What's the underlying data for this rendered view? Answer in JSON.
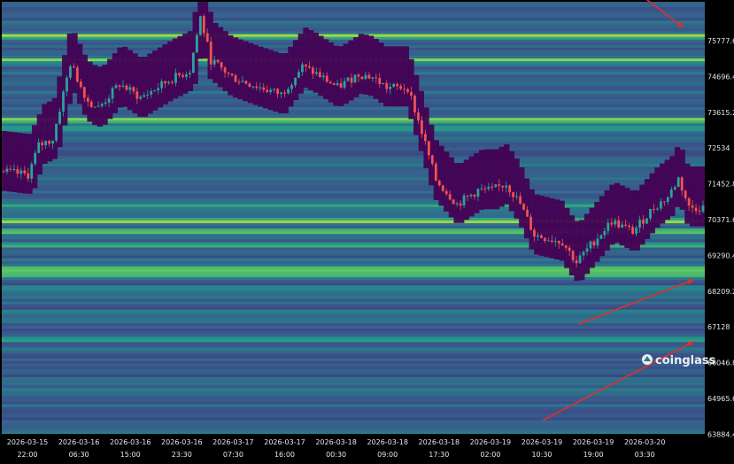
{
  "chart_data": {
    "type": "heatmap",
    "subtype": "liquidation-heatmap-with-candles",
    "title": "",
    "xlabel": "",
    "ylabel": "",
    "y_ticks": [
      "75777.6",
      "74696.4",
      "73615.2",
      "72534",
      "71452.8",
      "70371.6",
      "69290.4",
      "68209.2",
      "67128",
      "66046.8",
      "64965.6",
      "63884.4"
    ],
    "x_ticks": [
      {
        "date": "2026-03-15",
        "time": "22:00"
      },
      {
        "date": "2026-03-16",
        "time": "06:30"
      },
      {
        "date": "2026-03-16",
        "time": "15:00"
      },
      {
        "date": "2026-03-16",
        "time": "23:30"
      },
      {
        "date": "2026-03-17",
        "time": "07:30"
      },
      {
        "date": "2026-03-17",
        "time": "16:00"
      },
      {
        "date": "2026-03-18",
        "time": "00:30"
      },
      {
        "date": "2026-03-18",
        "time": "09:00"
      },
      {
        "date": "2026-03-18",
        "time": "17:30"
      },
      {
        "date": "2026-03-19",
        "time": "02:00"
      },
      {
        "date": "2026-03-19",
        "time": "10:30"
      },
      {
        "date": "2026-03-19",
        "time": "19:00"
      },
      {
        "date": "2026-03-20",
        "time": "03:30"
      }
    ],
    "ylim": [
      63800,
      76400
    ],
    "price_path": [
      {
        "t": 0,
        "p": 71450
      },
      {
        "t": 0.04,
        "p": 71350
      },
      {
        "t": 0.055,
        "p": 72200
      },
      {
        "t": 0.075,
        "p": 72400
      },
      {
        "t": 0.1,
        "p": 74600
      },
      {
        "t": 0.125,
        "p": 73500
      },
      {
        "t": 0.14,
        "p": 73300
      },
      {
        "t": 0.17,
        "p": 74000
      },
      {
        "t": 0.2,
        "p": 73600
      },
      {
        "t": 0.24,
        "p": 74100
      },
      {
        "t": 0.27,
        "p": 74400
      },
      {
        "t": 0.285,
        "p": 75950
      },
      {
        "t": 0.3,
        "p": 74700
      },
      {
        "t": 0.33,
        "p": 74200
      },
      {
        "t": 0.37,
        "p": 73900
      },
      {
        "t": 0.4,
        "p": 73700
      },
      {
        "t": 0.43,
        "p": 74500
      },
      {
        "t": 0.45,
        "p": 74300
      },
      {
        "t": 0.48,
        "p": 73900
      },
      {
        "t": 0.51,
        "p": 74300
      },
      {
        "t": 0.53,
        "p": 74200
      },
      {
        "t": 0.55,
        "p": 73900
      },
      {
        "t": 0.58,
        "p": 73900
      },
      {
        "t": 0.6,
        "p": 72600
      },
      {
        "t": 0.62,
        "p": 71200
      },
      {
        "t": 0.65,
        "p": 70500
      },
      {
        "t": 0.68,
        "p": 70900
      },
      {
        "t": 0.7,
        "p": 70900
      },
      {
        "t": 0.72,
        "p": 71100
      },
      {
        "t": 0.74,
        "p": 70500
      },
      {
        "t": 0.76,
        "p": 69600
      },
      {
        "t": 0.8,
        "p": 69400
      },
      {
        "t": 0.82,
        "p": 68800
      },
      {
        "t": 0.84,
        "p": 69300
      },
      {
        "t": 0.87,
        "p": 70000
      },
      {
        "t": 0.9,
        "p": 69700
      },
      {
        "t": 0.93,
        "p": 70400
      },
      {
        "t": 0.95,
        "p": 70700
      },
      {
        "t": 0.965,
        "p": 71250
      },
      {
        "t": 0.98,
        "p": 70400
      },
      {
        "t": 1,
        "p": 70400
      }
    ],
    "liquidity_bands": [
      {
        "price": 75400,
        "intensity": 0.95
      },
      {
        "price": 74700,
        "intensity": 0.85
      },
      {
        "price": 72950,
        "intensity": 0.95
      },
      {
        "price": 72700,
        "intensity": 0.7
      },
      {
        "price": 70450,
        "intensity": 0.6
      },
      {
        "price": 70000,
        "intensity": 0.95
      },
      {
        "price": 69700,
        "intensity": 0.9
      },
      {
        "price": 69300,
        "intensity": 0.75
      },
      {
        "price": 68600,
        "intensity": 0.95
      },
      {
        "price": 68450,
        "intensity": 0.9
      },
      {
        "price": 68050,
        "intensity": 0.6
      },
      {
        "price": 67350,
        "intensity": 0.55
      },
      {
        "price": 66550,
        "intensity": 0.7
      },
      {
        "price": 66250,
        "intensity": 0.5
      },
      {
        "price": 65300,
        "intensity": 0.45
      },
      {
        "price": 64600,
        "intensity": 0.4
      }
    ],
    "arrows": [
      {
        "from_t": 0.915,
        "from_p": 76500,
        "to_t": 0.97,
        "to_p": 75650
      },
      {
        "from_t": 0.82,
        "from_p": 67000,
        "to_t": 0.985,
        "to_p": 68300
      },
      {
        "from_t": 0.77,
        "from_p": 64200,
        "to_t": 0.985,
        "to_p": 66500
      }
    ],
    "colors": {
      "background": "#440154",
      "up": "#26a69a",
      "down": "#ef5350",
      "arrow": "#e0302a",
      "axis_bg": "#000000"
    },
    "watermark": "coinglass"
  }
}
